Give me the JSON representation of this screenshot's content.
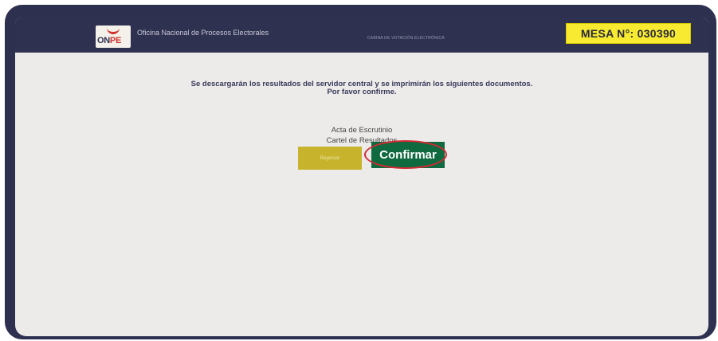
{
  "header": {
    "logo_text": "ONPE",
    "org_name": "Oficina Nacional de Procesos Electorales",
    "subtitle": "CABINA DE VOTACIÓN ELECTRÓNICA",
    "mesa_label": "MESA N°: 030390"
  },
  "main": {
    "message_line1": "Se descargarán los resultados del servidor central y se imprimirán los siguientes documentos.",
    "message_line2": "Por favor confirme.",
    "documents": [
      "Acta de Escrutinio",
      "Cartel de Resultados"
    ]
  },
  "actions": {
    "back_label": "Regresar",
    "confirm_label": "Confirmar"
  },
  "colors": {
    "frame": "#2e3050",
    "header": "#2f3150",
    "mesa_badge": "#f7ea31",
    "back_button": "#c7b42c",
    "confirm_button": "#0f6a3f",
    "highlight": "#d62833"
  }
}
